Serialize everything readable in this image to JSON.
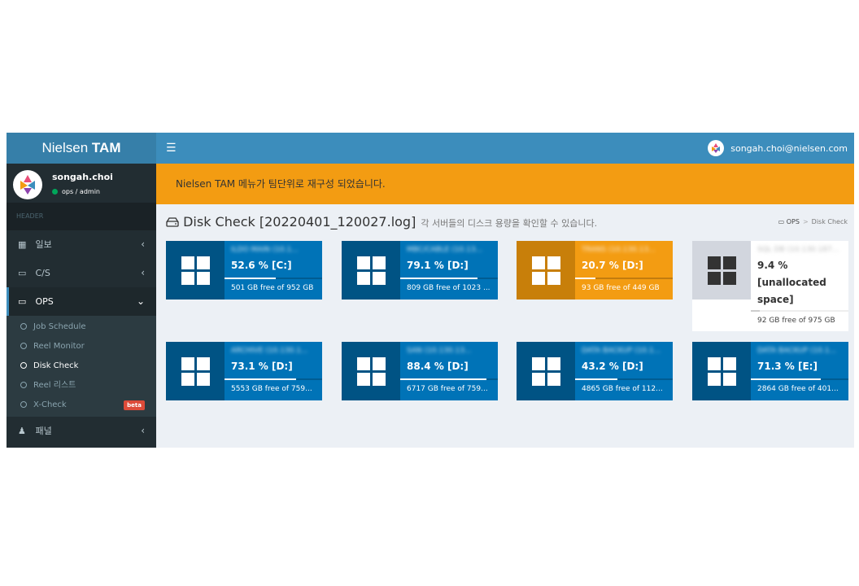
{
  "app": {
    "logo_light": "Nielsen ",
    "logo_bold": "TAM"
  },
  "topbar": {
    "menu_icon": "hamburger-icon",
    "user_email": "songah.choi@nielsen.com"
  },
  "user": {
    "name": "songah.choi",
    "role": "ops / admin"
  },
  "sidebar": {
    "header": "HEADER",
    "items": [
      {
        "label": "일보",
        "icon": "calendar-icon"
      },
      {
        "label": "C/S",
        "icon": "laptop-icon"
      },
      {
        "label": "OPS",
        "icon": "desktop-icon"
      },
      {
        "label": "패널",
        "icon": "user-icon"
      }
    ],
    "ops_sub": [
      {
        "label": "Job Schedule"
      },
      {
        "label": "Reel Monitor"
      },
      {
        "label": "Disk Check"
      },
      {
        "label": "Reel 리스트"
      },
      {
        "label": "X-Check",
        "badge": "beta"
      }
    ]
  },
  "notice": "Nielsen TAM 메뉴가 팀단위로 재구성 되었습니다.",
  "page": {
    "title": "Disk Check [20220401_120027.log]",
    "subtitle": "각 서버들의 디스크 용량을 확인할 수 있습니다.",
    "breadcrumb": [
      "OPS",
      "Disk Check"
    ]
  },
  "servers": [
    {
      "name": "ILDO MAIN (10.1...",
      "percent": "52.6 % [C:]",
      "usage": 52.6,
      "free": "501 GB free of 952 GB",
      "color": "#0073b7"
    },
    {
      "name": "MBC/CABLE (10.13...",
      "percent": "79.1 % [D:]",
      "usage": 79.1,
      "free": "809 GB free of 1023 ...",
      "color": "#0073b7"
    },
    {
      "name": "TRANS (10.130.13...",
      "percent": "20.7 % [D:]",
      "usage": 20.7,
      "free": "93 GB free of 449 GB",
      "color": "#f39c12"
    },
    {
      "name": "SQL DB (10.130.187...",
      "percent": "9.4 % [unallocated space]",
      "usage": 9.4,
      "free": "92 GB free of 975 GB",
      "color": "#ffffff"
    },
    {
      "name": "ARCHIVE (10.130.1...",
      "percent": "73.1 % [D:]",
      "usage": 73.1,
      "free": "5553 GB free of 759...",
      "color": "#0073b7"
    },
    {
      "name": "SAN (10.130.13...",
      "percent": "88.4 % [D:]",
      "usage": 88.4,
      "free": "6717 GB free of 759...",
      "color": "#0073b7"
    },
    {
      "name": "DATA BACKUP (10.1...",
      "percent": "43.2 % [D:]",
      "usage": 43.2,
      "free": "4865 GB free of 112...",
      "color": "#0073b7"
    },
    {
      "name": "DATA BACKUP (10.1...",
      "percent": "71.3 % [E:]",
      "usage": 71.3,
      "free": "2864 GB free of 401...",
      "color": "#0073b7"
    }
  ]
}
